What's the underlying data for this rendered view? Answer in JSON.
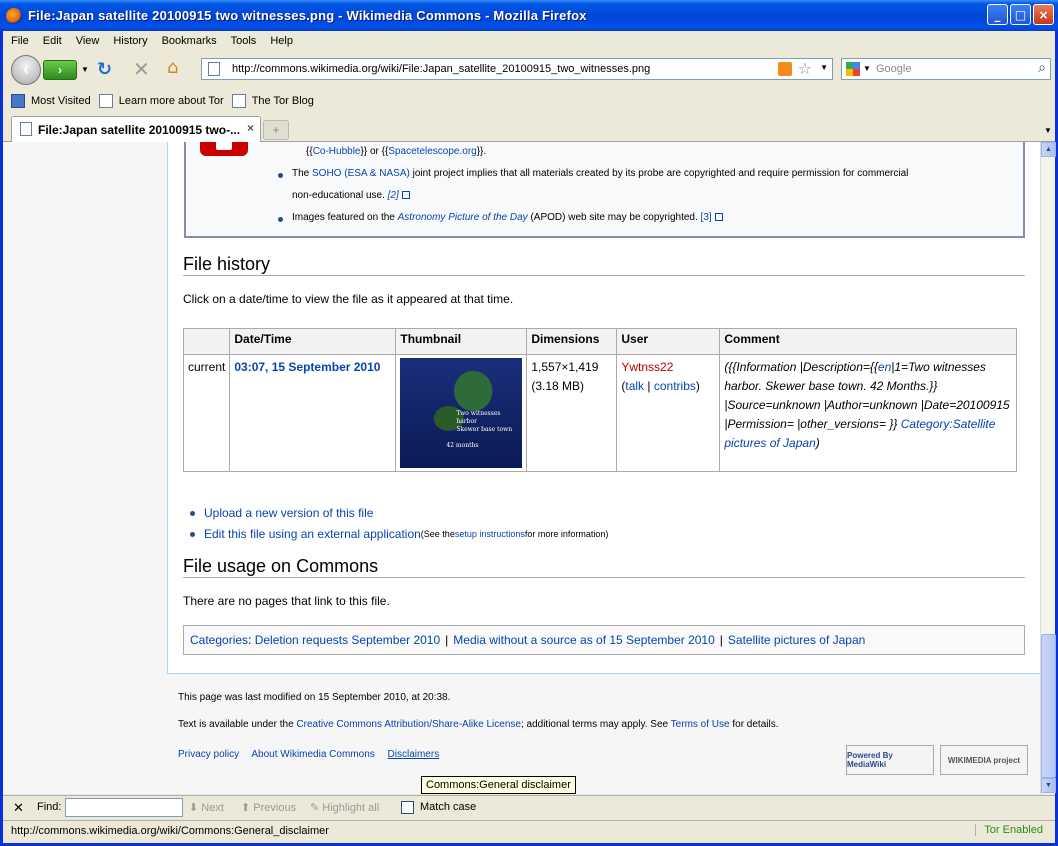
{
  "window": {
    "title": "File:Japan satellite 20100915 two witnesses.png - Wikimedia Commons - Mozilla Firefox"
  },
  "menu": [
    "File",
    "Edit",
    "View",
    "History",
    "Bookmarks",
    "Tools",
    "Help"
  ],
  "url": "http://commons.wikimedia.org/wiki/File:Japan_satellite_20100915_two_witnesses.png",
  "search_placeholder": "Google",
  "bookmarks": [
    "Most Visited",
    "Learn more about Tor",
    "The Tor Blog"
  ],
  "tab": {
    "label": "File:Japan satellite 20100915 two-...",
    "close": "×",
    "new": "+"
  },
  "notice": {
    "line0_pre": "{{",
    "line0_link1": "Co-Hubble",
    "line0_mid": "}} or {{",
    "line0_link2": "Spacetelescope.org",
    "line0_post": "}}.",
    "soho_pre": "The ",
    "soho_link": "SOHO (ESA & NASA)",
    "soho_post": " joint project implies that all materials created by its probe are copyrighted and require permission for commercial",
    "soho_line2": "non-educational use. ",
    "soho_ref": "[2]",
    "apod_pre": "Images featured on the ",
    "apod_link": "Astronomy Picture of the Day",
    "apod_post": " (APOD) web site may be copyrighted. ",
    "apod_ref": "[3]"
  },
  "file_history": {
    "heading": "File history",
    "intro": "Click on a date/time to view the file as it appeared at that time.",
    "columns": [
      "",
      "Date/Time",
      "Thumbnail",
      "Dimensions",
      "User",
      "Comment"
    ],
    "row": {
      "status": "current",
      "datetime": "03:07, 15 September 2010",
      "dims": "1,557×1,419",
      "size": "(3.18 MB)",
      "user": "Ywtnss22",
      "talk": "talk",
      "contribs": "contribs",
      "comment_a": "({{Information |Description={{",
      "comment_en": "en",
      "comment_b": "|1=Two witnesses harbor. Skewer base town. 42 Months.}} |Source=unknown |Author=unknown |Date=20100915 |Permission= |other_versions= }}",
      "comment_cat": "Category:Satellite pictures of Japan",
      "comment_end": ")",
      "thumb_label1": "Two witnesses harbor",
      "thumb_label2": "Skewer base town",
      "thumb_label3": "42 months"
    }
  },
  "actions": {
    "upload": "Upload a new version of this file",
    "edit": "Edit this file using an external application",
    "edit_note_pre": " (See the ",
    "edit_note_link": "setup instructions",
    "edit_note_post": " for more information)"
  },
  "file_usage": {
    "heading": "File usage on Commons",
    "text": "There are no pages that link to this file."
  },
  "categories": {
    "label": "Categories",
    "items": [
      "Deletion requests September 2010",
      "Media without a source as of 15 September 2010",
      "Satellite pictures of Japan"
    ]
  },
  "footer": {
    "modified": "This page was last modified on 15 September 2010, at 20:38.",
    "license_pre": "Text is available under the ",
    "license_link": "Creative Commons Attribution/Share-Alike License",
    "license_mid": "; additional terms may apply. See ",
    "terms_link": "Terms of Use",
    "license_post": " for details.",
    "links": [
      "Privacy policy",
      "About Wikimedia Commons",
      "Disclaimers"
    ],
    "badge_mediawiki": "Powered By MediaWiki",
    "badge_wikimedia": "WIKIMEDIA project"
  },
  "tooltip": "Commons:General disclaimer",
  "findbar": {
    "label": "Find:",
    "value": "",
    "next": "Next",
    "previous": "Previous",
    "highlight": "Highlight all",
    "matchcase": "Match case"
  },
  "status": {
    "url": "http://commons.wikimedia.org/wiki/Commons:General_disclaimer",
    "tor": "Tor Enabled"
  },
  "colors": {
    "link": "#0645ad",
    "redlink": "#ba0000",
    "titlebar": "#0058e6"
  }
}
